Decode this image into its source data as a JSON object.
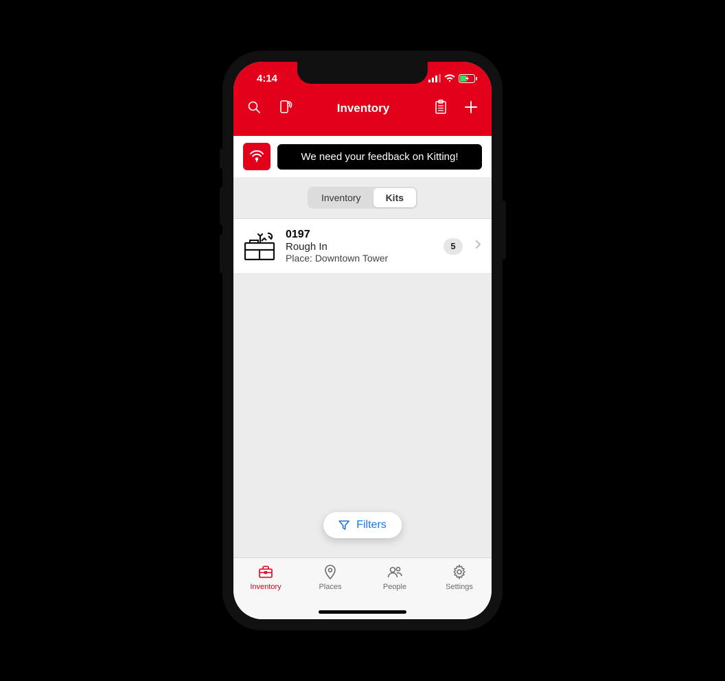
{
  "status": {
    "time": "4:14"
  },
  "header": {
    "title": "Inventory"
  },
  "banner": {
    "text": "We need your feedback on Kitting!"
  },
  "segmented": {
    "items": [
      "Inventory",
      "Kits"
    ],
    "active": 1
  },
  "list": {
    "items": [
      {
        "code": "0197",
        "name": "Rough In",
        "place_label": "Place:",
        "place": "Downtown Tower",
        "count": "5"
      }
    ]
  },
  "filters_label": "Filters",
  "tabs": [
    "Inventory",
    "Places",
    "People",
    "Settings"
  ],
  "active_tab": 0
}
